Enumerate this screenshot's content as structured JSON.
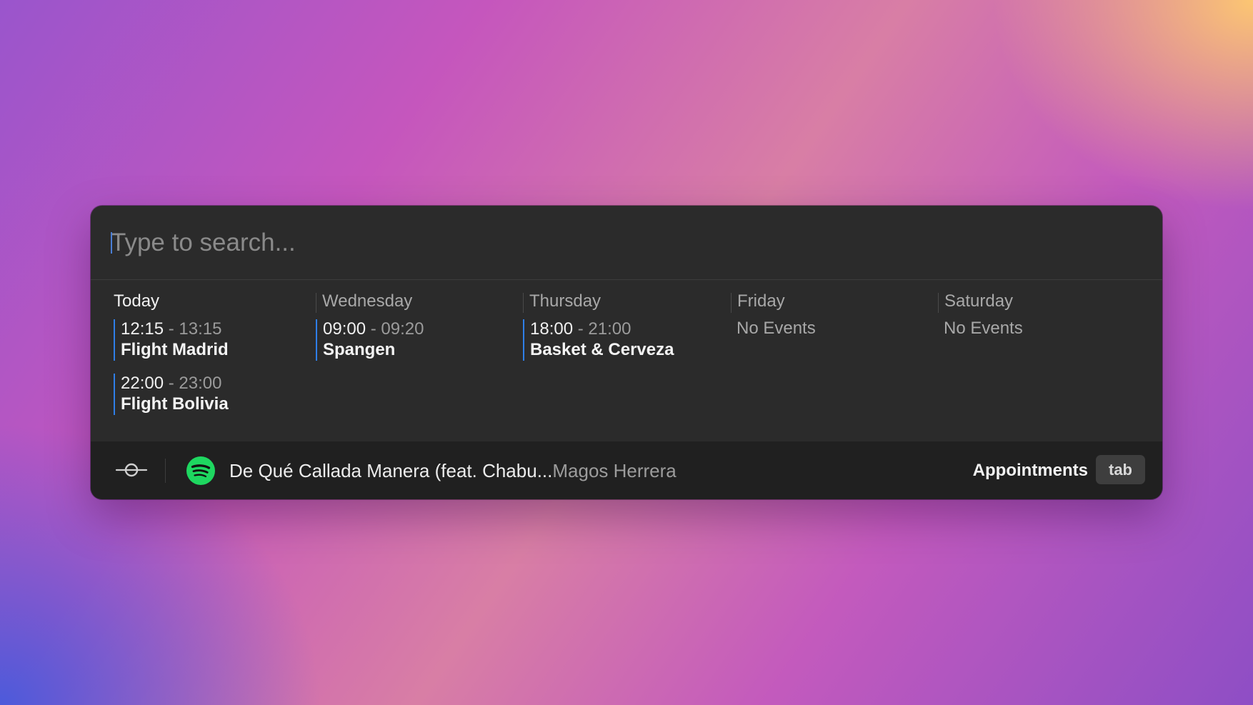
{
  "search": {
    "placeholder": "Type to search..."
  },
  "calendar": {
    "days": [
      {
        "label": "Today",
        "events": [
          {
            "start": "12:15",
            "end": "13:15",
            "title": "Flight Madrid"
          },
          {
            "start": "22:00",
            "end": "23:00",
            "title": "Flight Bolivia"
          }
        ]
      },
      {
        "label": "Wednesday",
        "events": [
          {
            "start": "09:00",
            "end": "09:20",
            "title": "Spangen"
          }
        ]
      },
      {
        "label": "Thursday",
        "events": [
          {
            "start": "18:00",
            "end": "21:00",
            "title": "Basket & Cerveza"
          }
        ]
      },
      {
        "label": "Friday",
        "empty_text": "No Events"
      },
      {
        "label": "Saturday",
        "empty_text": "No Events"
      }
    ],
    "time_separator": "-"
  },
  "footer": {
    "now_playing": {
      "track": "De Qué Callada Manera (feat. Chabu...",
      "artist": "Magos Herrera",
      "app_icon": "spotify-icon"
    },
    "action_label": "Appointments",
    "action_key": "tab",
    "left_icon": "command-icon"
  },
  "colors": {
    "event_accent": "#2f7fe8",
    "spotify_green": "#1ed760",
    "panel_bg": "#2b2b2b",
    "footer_bg": "#202020"
  }
}
